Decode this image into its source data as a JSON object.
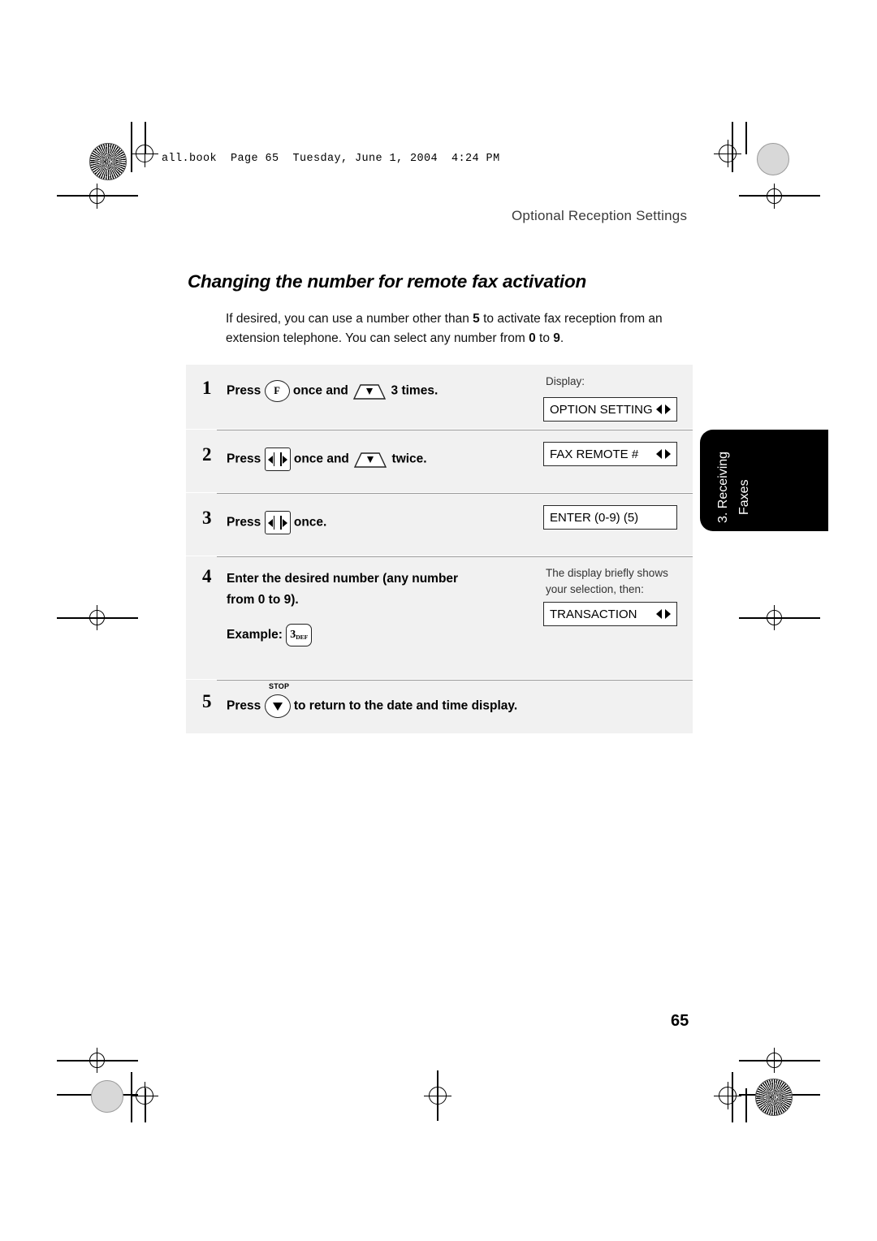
{
  "slug": "all.book  Page 65  Tuesday, June 1, 2004  4:24 PM",
  "running_head": "Optional Reception Settings",
  "page_title": "Changing the number for remote fax activation",
  "intro": {
    "part1": "If desired, you can use a number other than ",
    "bold1": "5",
    "part2": " to activate fax reception from an extension telephone. You can select any number from ",
    "bold2": "0",
    "part3": " to ",
    "bold3": "9",
    "part4": "."
  },
  "display_label": "Display:",
  "steps": [
    {
      "num": "1",
      "text_before": "Press",
      "key1": "F",
      "text_mid": "once and",
      "key2": "down-arrow-key",
      "text_after": "3 times.",
      "lcd": "OPTION SETTING"
    },
    {
      "num": "2",
      "text_before": "Press",
      "key1": "right-left-arrow-key",
      "text_mid": "once and",
      "key2": "down-arrow-key",
      "text_after": "twice.",
      "lcd": "FAX REMOTE #"
    },
    {
      "num": "3",
      "text_before": "Press",
      "key1": "right-left-arrow-key",
      "text_after": "once.",
      "lcd": "ENTER (0-9) (5)"
    },
    {
      "num": "4",
      "line1": "Enter the desired number (any number",
      "line2": "from 0 to 9).",
      "example_label": "Example:",
      "example_key": "3",
      "example_key_sub": "DEF",
      "note1": "The display briefly shows",
      "note2": "your selection, then:",
      "lcd": "TRANSACTION"
    },
    {
      "num": "5",
      "text_before": "Press",
      "stop_label": "STOP",
      "text_after": "to return to the date and time display."
    }
  ],
  "side_tab": {
    "line1": "3. Receiving",
    "line2": "Faxes"
  },
  "page_number": "65"
}
